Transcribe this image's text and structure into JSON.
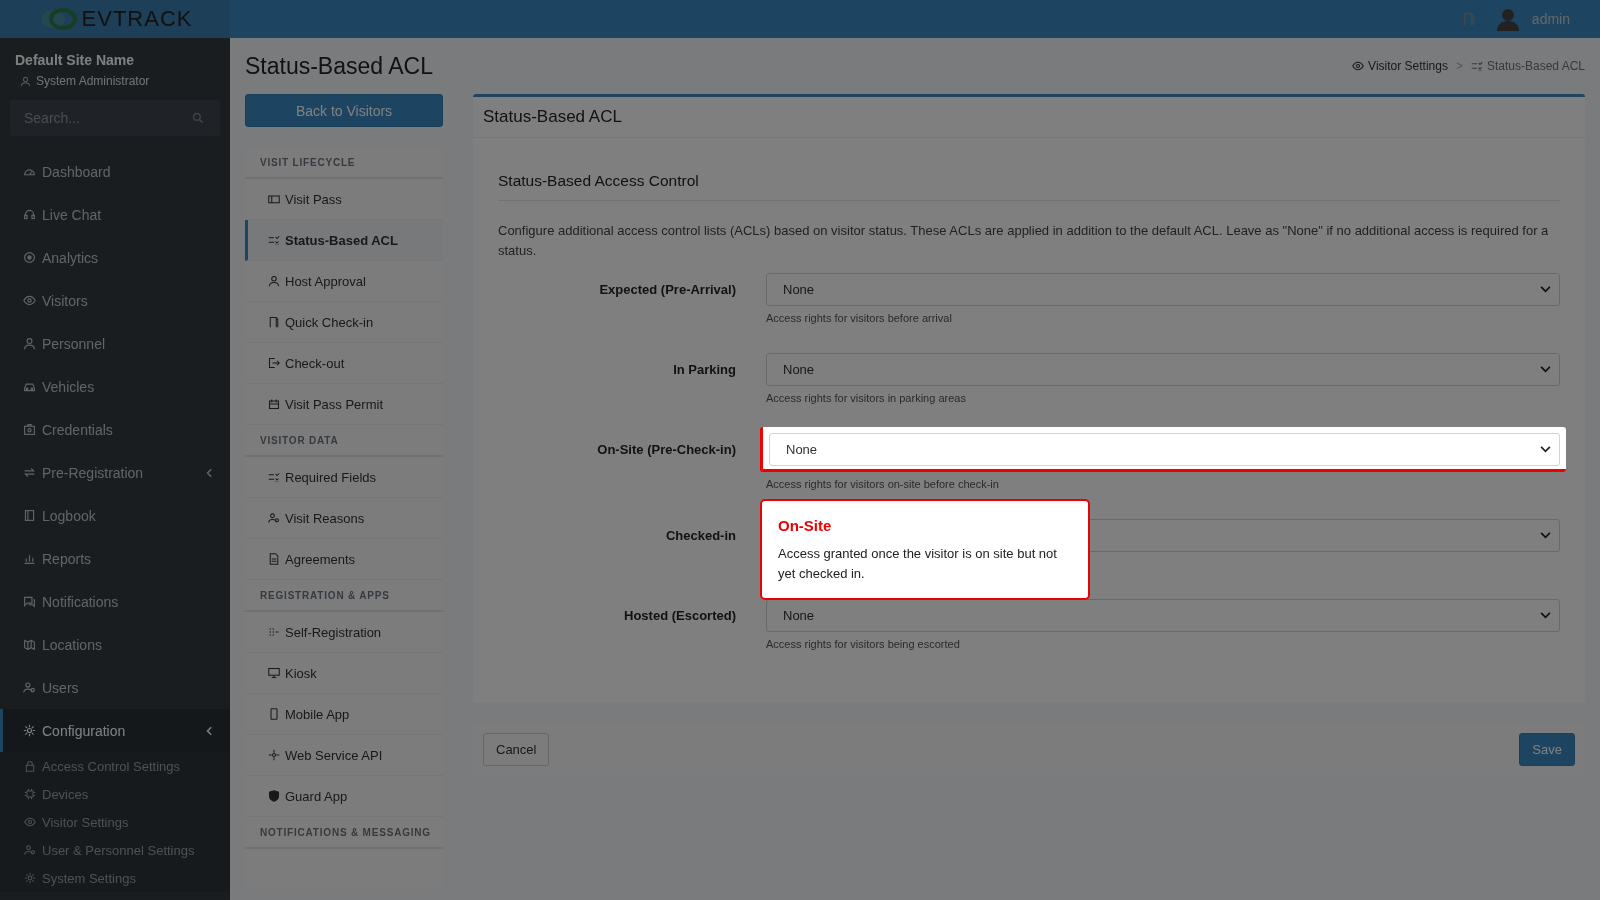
{
  "topbar": {
    "logo": "**EV**TRACK",
    "user": "admin"
  },
  "sidebar": {
    "site_name": "Default Site Name",
    "role": "System Administrator",
    "search": {
      "placeholder": "Search..."
    },
    "items": [
      {
        "label": "Dashboard",
        "selected": false,
        "expandable": false
      },
      {
        "label": "Live Chat",
        "selected": false,
        "expandable": false
      },
      {
        "label": "Analytics",
        "selected": false,
        "expandable": false
      },
      {
        "label": "Visitors",
        "selected": false,
        "expandable": false
      },
      {
        "label": "Personnel",
        "selected": false,
        "expandable": false
      },
      {
        "label": "Vehicles",
        "selected": false,
        "expandable": false
      },
      {
        "label": "Credentials",
        "selected": false,
        "expandable": false
      },
      {
        "label": "Pre-Registration",
        "selected": false,
        "expandable": true
      },
      {
        "label": "Logbook",
        "selected": false,
        "expandable": false
      },
      {
        "label": "Reports",
        "selected": false,
        "expandable": false
      },
      {
        "label": "Notifications",
        "selected": false,
        "expandable": false
      },
      {
        "label": "Locations",
        "selected": false,
        "expandable": false
      },
      {
        "label": "Users",
        "selected": false,
        "expandable": false
      },
      {
        "label": "Configuration",
        "selected": true,
        "expandable": true,
        "children": [
          {
            "label": "Access Control Settings"
          },
          {
            "label": "Devices"
          },
          {
            "label": "Visitor Settings"
          },
          {
            "label": "User & Personnel Settings"
          },
          {
            "label": "System Settings"
          }
        ]
      }
    ]
  },
  "page_title": "Status-Based ACL",
  "breadcrumb": [
    {
      "label": "Visitor Settings"
    },
    {
      "label": ">",
      "kind": "separator"
    },
    {
      "label": "Status-Based ACL"
    }
  ],
  "back_button": "Back to Visitors",
  "settings_nav": [
    {
      "title": "VISIT LIFECYCLE",
      "items": [
        {
          "label": "Visit Pass",
          "selected": false
        },
        {
          "label": "Status-Based ACL",
          "selected": true
        },
        {
          "label": "Host Approval",
          "selected": false
        },
        {
          "label": "Quick Check-in",
          "selected": false
        },
        {
          "label": "Check-out",
          "selected": false
        },
        {
          "label": "Visit Pass Permit",
          "selected": false
        }
      ]
    },
    {
      "title": "VISITOR DATA",
      "items": [
        {
          "label": "Required Fields",
          "selected": false
        },
        {
          "label": "Visit Reasons",
          "selected": false
        },
        {
          "label": "Agreements",
          "selected": false
        }
      ]
    },
    {
      "title": "REGISTRATION & APPS",
      "items": [
        {
          "label": "Self-Registration",
          "selected": false
        },
        {
          "label": "Kiosk",
          "selected": false
        },
        {
          "label": "Mobile App",
          "selected": false
        },
        {
          "label": "Web Service API",
          "selected": false
        },
        {
          "label": "Guard App",
          "selected": false
        }
      ]
    },
    {
      "title": "NOTIFICATIONS & MESSAGING"
    }
  ],
  "card": {
    "title": "Status-Based ACL",
    "section_title": "Status-Based Access Control",
    "description": "Configure additional access control lists (ACLs) based on visitor status. These ACLs are applied in addition to the default ACL. Leave as \"None\" if no additional access is required for a status.",
    "fields": [
      {
        "label": "Expected (Pre-Arrival)",
        "value": "None",
        "hint": "Access rights for visitors before arrival",
        "highlighted": false
      },
      {
        "label": "In Parking",
        "value": "None",
        "hint": "Access rights for visitors in parking areas",
        "highlighted": false
      },
      {
        "label": "On-Site (Pre-Check-in)",
        "value": "None",
        "hint": "Access rights for visitors on-site before check-in",
        "highlighted": true
      },
      {
        "label": "Checked-in",
        "highlighted": false
      },
      {
        "label": "Hosted (Escorted)",
        "value": "None",
        "hint": "Access rights for visitors being escorted",
        "highlighted": false
      }
    ]
  },
  "tour_tip": {
    "title": "On-Site",
    "text": "Access granted once the visitor is on site but not yet checked in."
  },
  "footer": {
    "cancel": "Cancel",
    "save": "Save"
  }
}
